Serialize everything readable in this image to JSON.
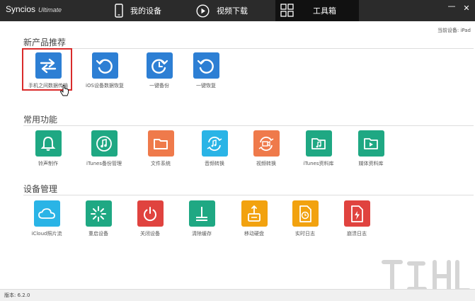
{
  "app": {
    "name": "Syncios",
    "edition": "Ultimate"
  },
  "nav": [
    {
      "label": "我的设备",
      "icon": "phone-icon"
    },
    {
      "label": "视频下载",
      "icon": "play-icon"
    },
    {
      "label": "工具箱",
      "icon": "toolbox-icon",
      "active": true
    }
  ],
  "window_controls": {
    "minimize": "—",
    "close": "✕"
  },
  "current_device": "当前设备: iPad",
  "sections": [
    {
      "title": "新产品推荐",
      "items": [
        {
          "label": "手机之间数据传输",
          "icon": "transfer-icon",
          "color": "#2d7fd4"
        },
        {
          "label": "iOS设备数据恢复",
          "icon": "restore-icon",
          "color": "#2d7fd4"
        },
        {
          "label": "一键备份",
          "icon": "backup-icon",
          "color": "#2d7fd4"
        },
        {
          "label": "一键恢复",
          "icon": "restore-icon",
          "color": "#2d7fd4"
        }
      ]
    },
    {
      "title": "常用功能",
      "items": [
        {
          "label": "铃声制作",
          "icon": "bell-icon",
          "color": "#1fa883"
        },
        {
          "label": "iTunes备份管理",
          "icon": "music-note-icon",
          "color": "#1fa883"
        },
        {
          "label": "文件系统",
          "icon": "folder-icon",
          "color": "#ef7a4b"
        },
        {
          "label": "音频转换",
          "icon": "audio-convert-icon",
          "color": "#2ab4e6"
        },
        {
          "label": "视频转换",
          "icon": "video-convert-icon",
          "color": "#ef7a4b"
        },
        {
          "label": "iTunes资料库",
          "icon": "music-folder-icon",
          "color": "#1fa883"
        },
        {
          "label": "媒体资料库",
          "icon": "media-folder-icon",
          "color": "#1fa883"
        }
      ]
    },
    {
      "title": "设备管理",
      "items": [
        {
          "label": "iCloud照片流",
          "icon": "cloud-icon",
          "color": "#2ab4e6"
        },
        {
          "label": "重启设备",
          "icon": "reboot-icon",
          "color": "#1fa883"
        },
        {
          "label": "关闭设备",
          "icon": "power-icon",
          "color": "#e0433f"
        },
        {
          "label": "清除缓存",
          "icon": "broom-icon",
          "color": "#1fa883"
        },
        {
          "label": "移动硬盘",
          "icon": "usb-drive-icon",
          "color": "#f2a20f"
        },
        {
          "label": "实时日志",
          "icon": "log-icon",
          "color": "#f2a20f"
        },
        {
          "label": "崩溃日志",
          "icon": "crash-log-icon",
          "color": "#e0433f"
        }
      ]
    }
  ],
  "version": "版本: 6.2.0"
}
